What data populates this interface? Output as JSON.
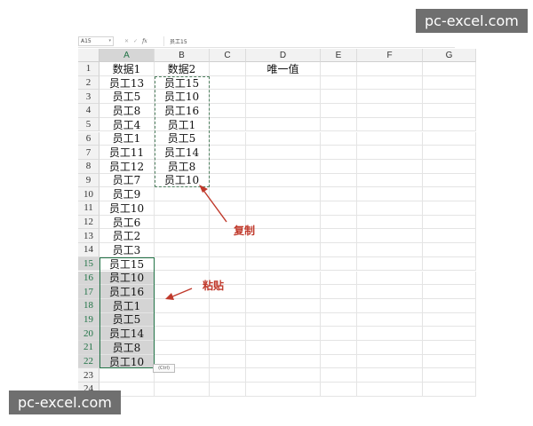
{
  "formula_bar": {
    "name_box": "A15",
    "dropdown_icon": "chevron-down-icon",
    "cancel_icon": "close-icon",
    "enter_icon": "check-icon",
    "fx_label": "fx",
    "value": "员工15"
  },
  "columns": [
    "A",
    "B",
    "C",
    "D",
    "E",
    "F",
    "G"
  ],
  "rows": [
    "1",
    "2",
    "3",
    "4",
    "5",
    "6",
    "7",
    "8",
    "9",
    "10",
    "11",
    "12",
    "13",
    "14",
    "15",
    "16",
    "17",
    "18",
    "19",
    "20",
    "21",
    "22",
    "23",
    "24"
  ],
  "column_a": [
    "数据1",
    "员工13",
    "员工5",
    "员工8",
    "员工4",
    "员工1",
    "员工11",
    "员工12",
    "员工7",
    "员工9",
    "员工10",
    "员工6",
    "员工2",
    "员工3",
    "员工15",
    "员工10",
    "员工16",
    "员工1",
    "员工5",
    "员工14",
    "员工8",
    "员工10"
  ],
  "column_b": [
    "数据2",
    "员工15",
    "员工10",
    "员工16",
    "员工1",
    "员工5",
    "员工14",
    "员工8",
    "员工10"
  ],
  "d1": "唯一值",
  "paste_options_label": "(Ctrl)",
  "annotations": {
    "copy": "复制",
    "paste": "粘贴"
  },
  "watermarks": {
    "top": "pc-excel.com",
    "bottom": "pc-excel.com"
  },
  "colors": {
    "selection": "#217346",
    "annotation": "#c0392b",
    "selected_fill": "#d4d4d4"
  }
}
